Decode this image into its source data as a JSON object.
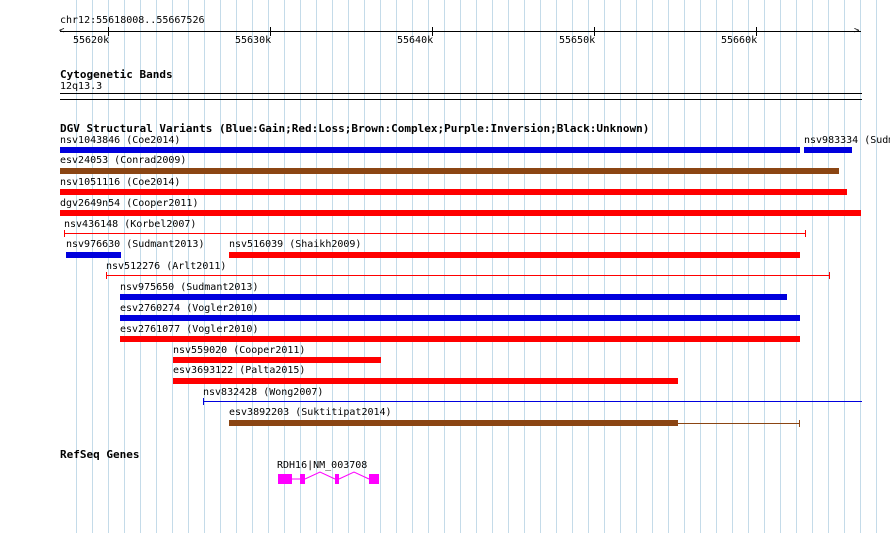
{
  "ruler": {
    "location": "chr12:55618008..55667526",
    "labels": [
      "55620k",
      "55630k",
      "55640k",
      "55650k",
      "55660k"
    ]
  },
  "cytoband": {
    "title": "Cytogenetic Bands",
    "band": "12q13.3"
  },
  "dgv": {
    "title": "DGV Structural Variants (Blue:Gain;Red:Loss;Brown:Complex;Purple:Inversion;Black:Unknown)",
    "colors": {
      "gain": "#0000dd",
      "loss": "#ff0000",
      "complex": "#8b4513"
    },
    "variants": [
      {
        "id": "v0",
        "label": "nsv1043846 (Coe2014)",
        "type": "gain",
        "style": "bar"
      },
      {
        "id": "v1",
        "label": "nsv983334 (Sudm",
        "type": "gain",
        "style": "bar"
      },
      {
        "id": "v2",
        "label": "esv24053 (Conrad2009)",
        "type": "complex",
        "style": "bar"
      },
      {
        "id": "v3",
        "label": "nsv1051116 (Coe2014)",
        "type": "loss",
        "style": "bar"
      },
      {
        "id": "v4",
        "label": "dgv2649n54 (Cooper2011)",
        "type": "loss",
        "style": "bar"
      },
      {
        "id": "v5",
        "label": "nsv436148 (Korbel2007)",
        "type": "loss",
        "style": "line"
      },
      {
        "id": "v6",
        "label": "nsv976630 (Sudmant2013)",
        "type": "gain",
        "style": "bar"
      },
      {
        "id": "v7",
        "label": "nsv516039 (Shaikh2009)",
        "type": "loss",
        "style": "bar"
      },
      {
        "id": "v8",
        "label": "nsv512276 (Arlt2011)",
        "type": "loss",
        "style": "line"
      },
      {
        "id": "v9",
        "label": "nsv975650 (Sudmant2013)",
        "type": "gain",
        "style": "bar"
      },
      {
        "id": "v10",
        "label": "esv2760274 (Vogler2010)",
        "type": "gain",
        "style": "bar"
      },
      {
        "id": "v11",
        "label": "esv2761077 (Vogler2010)",
        "type": "loss",
        "style": "bar"
      },
      {
        "id": "v12",
        "label": "nsv559020 (Cooper2011)",
        "type": "loss",
        "style": "bar"
      },
      {
        "id": "v13",
        "label": "esv3693122 (Palta2015)",
        "type": "loss",
        "style": "bar"
      },
      {
        "id": "v14",
        "label": "nsv832428 (Wong2007)",
        "type": "gain",
        "style": "line"
      },
      {
        "id": "v15",
        "label": "esv3892203 (Suktitipat2014)",
        "type": "complex",
        "style": "bar+line"
      }
    ]
  },
  "refseq": {
    "title": "RefSeq Genes",
    "gene_label": "RDH16|NM_003708",
    "gene_color": "#ff00ff"
  }
}
